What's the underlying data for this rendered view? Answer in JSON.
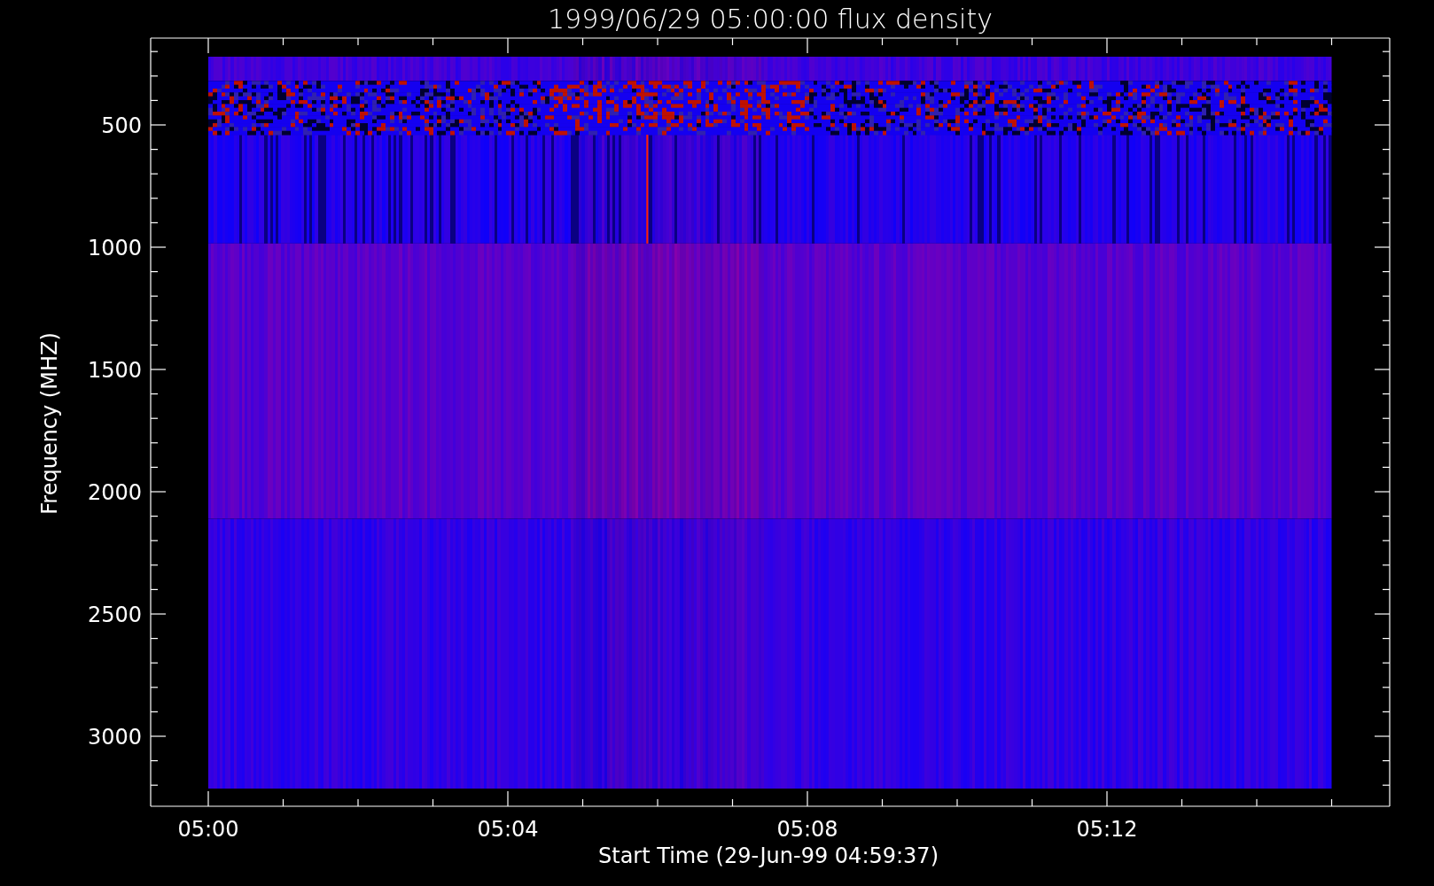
{
  "title": "1999/06/29 05:00:00 flux density",
  "y_axis": {
    "label": "Frequency (MHZ)",
    "ticks": [
      "500",
      "1000",
      "1500",
      "2000",
      "2500",
      "3000"
    ]
  },
  "x_axis": {
    "label": "Start Time (29-Jun-99 04:59:37)",
    "ticks": [
      "05:00",
      "05:04",
      "05:08",
      "05:12"
    ]
  }
}
